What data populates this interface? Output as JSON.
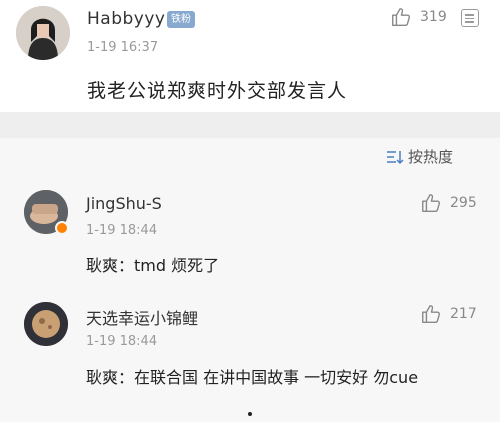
{
  "main_post": {
    "username": "Habbyyy",
    "badge": "铁粉",
    "time": "1-19 16:37",
    "likes": "319",
    "text": "我老公说郑爽时外交部发言人"
  },
  "sort": {
    "label": "按热度"
  },
  "comments": [
    {
      "username": "JingShu-S",
      "time": "1-19 18:44",
      "likes": "295",
      "text": "耿爽：tmd 烦死了"
    },
    {
      "username": "天选幸运小锦鲤",
      "time": "1-19 18:44",
      "likes": "217",
      "text": "耿爽：在联合国 在讲中国故事 一切安好 勿cue"
    }
  ],
  "icons": {
    "like": "thumbs-up-icon",
    "more": "more-icon",
    "sort": "sort-icon",
    "verified": "verified-badge-icon"
  },
  "colors": {
    "badge": "#88a9cf",
    "verified": "#ff8200",
    "meta_text": "#9a9a9a",
    "separator": "#eeeeee"
  }
}
